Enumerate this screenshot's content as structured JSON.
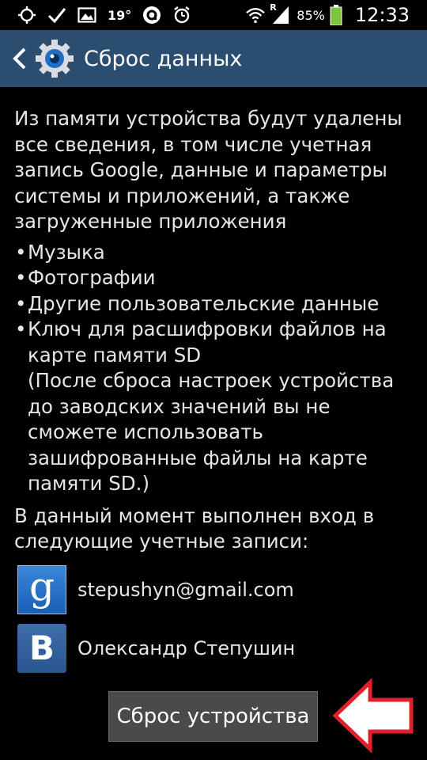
{
  "status_bar": {
    "temperature": "19°",
    "carrier_letter": "R",
    "battery": "85%",
    "time": "12:33",
    "icons": [
      "gps-icon",
      "check-icon",
      "gallery-icon",
      "temperature",
      "app-notification-icon",
      "alarm-icon",
      "wifi-icon",
      "signal-icon",
      "battery-icon"
    ]
  },
  "action_bar": {
    "title": "Сброс данных",
    "back_icon": "chevron-left-icon",
    "app_icon": "gear-icon"
  },
  "content": {
    "intro": "Из памяти устройства будут удалены все сведения, в том числе учетная запись Google, данные и параметры системы и приложений, а также загруженные приложения",
    "bullets": [
      "Музыка",
      "Фотографии",
      "Другие пользовательские данные",
      "Ключ для расшифровки файлов на карте памяти SD"
    ],
    "note": "(После сброса настроек устройства до заводских значений вы не сможете использовать зашифрованные файлы на карте памяти SD.)",
    "logged_in_text": "В данный момент выполнен вход в следующие учетные записи:",
    "accounts": [
      {
        "icon": "google-icon",
        "label": "stepushyn@gmail.com"
      },
      {
        "icon": "vk-icon",
        "label": "Олександр Степушин"
      }
    ]
  },
  "reset_button": {
    "label": "Сброс устройства"
  },
  "colors": {
    "action_bar": "#2b4d70",
    "background": "#000000",
    "arrow": "#e0202a",
    "button": "#4a4a4a",
    "battery": "#7dc63c"
  }
}
